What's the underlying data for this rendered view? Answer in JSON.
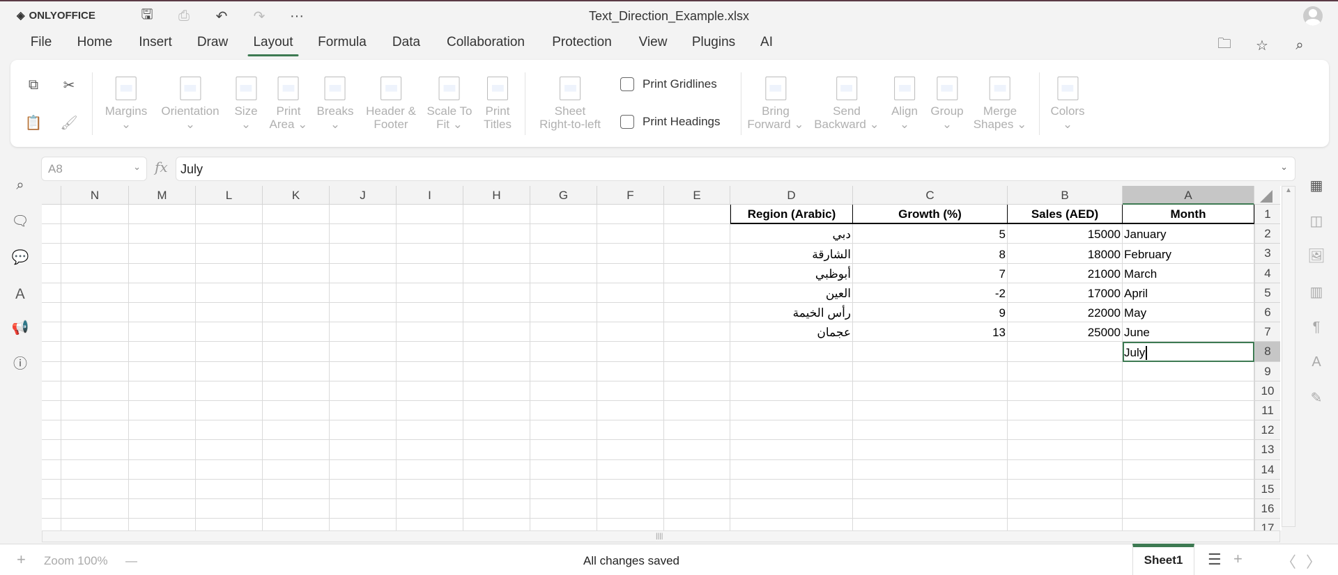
{
  "app": {
    "logo": "ONLYOFFICE",
    "title": "Text_Direction_Example.xlsx"
  },
  "quick_access": [
    {
      "icon": "save-icon",
      "glyph": "💾"
    },
    {
      "icon": "print-icon",
      "glyph": "⎙"
    },
    {
      "icon": "undo-icon",
      "glyph": "↶"
    },
    {
      "icon": "redo-icon",
      "glyph": "↷"
    },
    {
      "icon": "more-icon",
      "glyph": "···"
    }
  ],
  "menu": {
    "items": [
      "File",
      "Home",
      "Insert",
      "Draw",
      "Layout",
      "Formula",
      "Data",
      "Collaboration",
      "Protection",
      "View",
      "Plugins",
      "AI"
    ],
    "active": "Layout"
  },
  "ribbon": {
    "clipboard": [
      "copy",
      "cut",
      "paste",
      "format-painter"
    ],
    "buttons": [
      {
        "l1": "Margins",
        "l2": "⌄"
      },
      {
        "l1": "Orientation",
        "l2": "⌄"
      },
      {
        "l1": "Size",
        "l2": "⌄"
      },
      {
        "l1": "Print",
        "l2": "Area ⌄"
      },
      {
        "l1": "Breaks",
        "l2": "⌄"
      },
      {
        "l1": "Header &",
        "l2": "Footer"
      },
      {
        "l1": "Scale To",
        "l2": "Fit ⌄"
      },
      {
        "l1": "Print",
        "l2": "Titles"
      },
      {
        "l1": "Sheet",
        "l2": "Right-to-left"
      },
      {
        "l1": "Bring",
        "l2": "Forward ⌄"
      },
      {
        "l1": "Send",
        "l2": "Backward ⌄"
      },
      {
        "l1": "Align",
        "l2": "⌄"
      },
      {
        "l1": "Group",
        "l2": "⌄"
      },
      {
        "l1": "Merge",
        "l2": "Shapes ⌄"
      },
      {
        "l1": "Colors",
        "l2": "⌄"
      }
    ],
    "print_gridlines": {
      "label": "Print Gridlines",
      "checked": false
    },
    "print_headings": {
      "label": "Print Headings",
      "checked": false
    }
  },
  "formula_bar": {
    "name_box": "A8",
    "value": "July"
  },
  "sheet": {
    "columns": [
      "N",
      "M",
      "L",
      "K",
      "J",
      "I",
      "H",
      "G",
      "F",
      "E",
      "D",
      "C",
      "B",
      "A"
    ],
    "selected_column": "A",
    "row_numbers": [
      "1",
      "2",
      "3",
      "4",
      "5",
      "6",
      "7",
      "8",
      "9",
      "10",
      "11",
      "12",
      "13",
      "14",
      "15",
      "16",
      "17"
    ],
    "selected_row": "8",
    "headers": {
      "D": "Region (Arabic)",
      "C": "Growth (%)",
      "B": "Sales (AED)",
      "A": "Month"
    },
    "rows": [
      {
        "D": "دبي",
        "C": "5",
        "B": "15000",
        "A": "January"
      },
      {
        "D": "الشارقة",
        "C": "8",
        "B": "18000",
        "A": "February"
      },
      {
        "D": "أبوظبي",
        "C": "7",
        "B": "21000",
        "A": "March"
      },
      {
        "D": "العين",
        "C": "-2",
        "B": "17000",
        "A": "April"
      },
      {
        "D": "رأس الخيمة",
        "C": "9",
        "B": "22000",
        "A": "May"
      },
      {
        "D": "عجمان",
        "C": "13",
        "B": "25000",
        "A": "June"
      },
      {
        "D": "",
        "C": "",
        "B": "",
        "A": "July"
      }
    ],
    "active_cell": "A8"
  },
  "status": {
    "zoom": "Zoom 100%",
    "save_state": "All changes saved",
    "sheet_tab": "Sheet1"
  },
  "colors": {
    "accent": "#3d7a52"
  }
}
